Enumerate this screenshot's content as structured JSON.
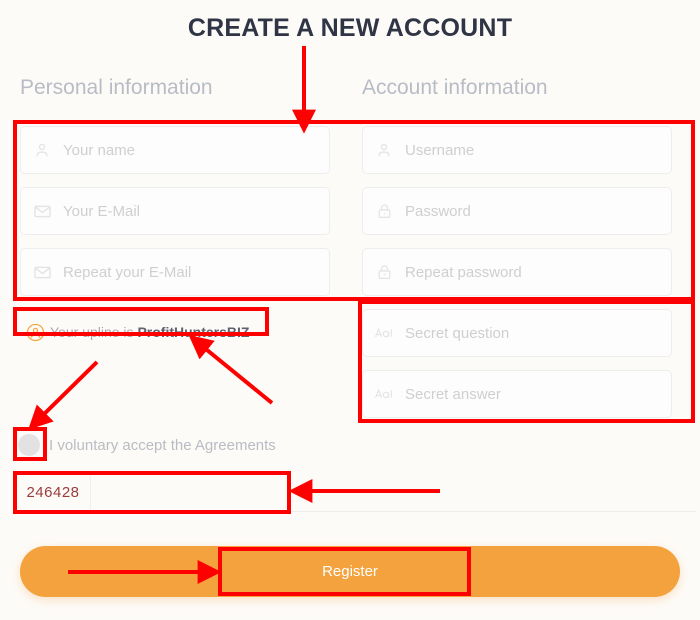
{
  "header": {
    "title": "CREATE A NEW ACCOUNT"
  },
  "sections": {
    "personal": {
      "heading": "Personal information",
      "fields": [
        {
          "icon": "user-icon",
          "placeholder": "Your name",
          "value": ""
        },
        {
          "icon": "envelope-icon",
          "placeholder": "Your E-Mail",
          "value": ""
        },
        {
          "icon": "envelope-icon",
          "placeholder": "Repeat your E-Mail",
          "value": ""
        }
      ]
    },
    "account": {
      "heading": "Account information",
      "fields": [
        {
          "icon": "user-icon",
          "placeholder": "Username",
          "value": ""
        },
        {
          "icon": "lock-icon",
          "placeholder": "Password",
          "value": ""
        },
        {
          "icon": "lock-icon",
          "placeholder": "Repeat password",
          "value": ""
        },
        {
          "icon": "text-icon",
          "placeholder": "Secret question",
          "value": ""
        },
        {
          "icon": "text-icon",
          "placeholder": "Secret answer",
          "value": ""
        }
      ]
    }
  },
  "upline": {
    "icon": "user-circle-icon",
    "prefix": "Your upline is ",
    "sponsor": "ProfitHuntersBIZ"
  },
  "agreement": {
    "label": "I voluntary accept the Agreements",
    "checked": false
  },
  "captcha": {
    "code": "246428",
    "input_value": "",
    "placeholder": ""
  },
  "actions": {
    "register_label": "Register"
  },
  "colors": {
    "accent_orange": "#f4a23e",
    "title_dark": "#2f3545",
    "placeholder_grey": "#cfcfcf",
    "heading_grey": "#b8bcc4",
    "captcha_red": "#9a3b3b",
    "annotation_red": "#ff0000",
    "page_background": "#fdfbf8"
  },
  "annotations": {
    "boxes": [
      "fields-group",
      "upline-row",
      "secret-group",
      "agreement-checkbox",
      "captcha-row",
      "register-button"
    ],
    "arrows": [
      "arrow-down-to-fields",
      "arrow-up-left-to-upline",
      "arrow-down-left-to-checkbox",
      "arrow-left-to-captcha",
      "arrow-right-to-register"
    ]
  }
}
